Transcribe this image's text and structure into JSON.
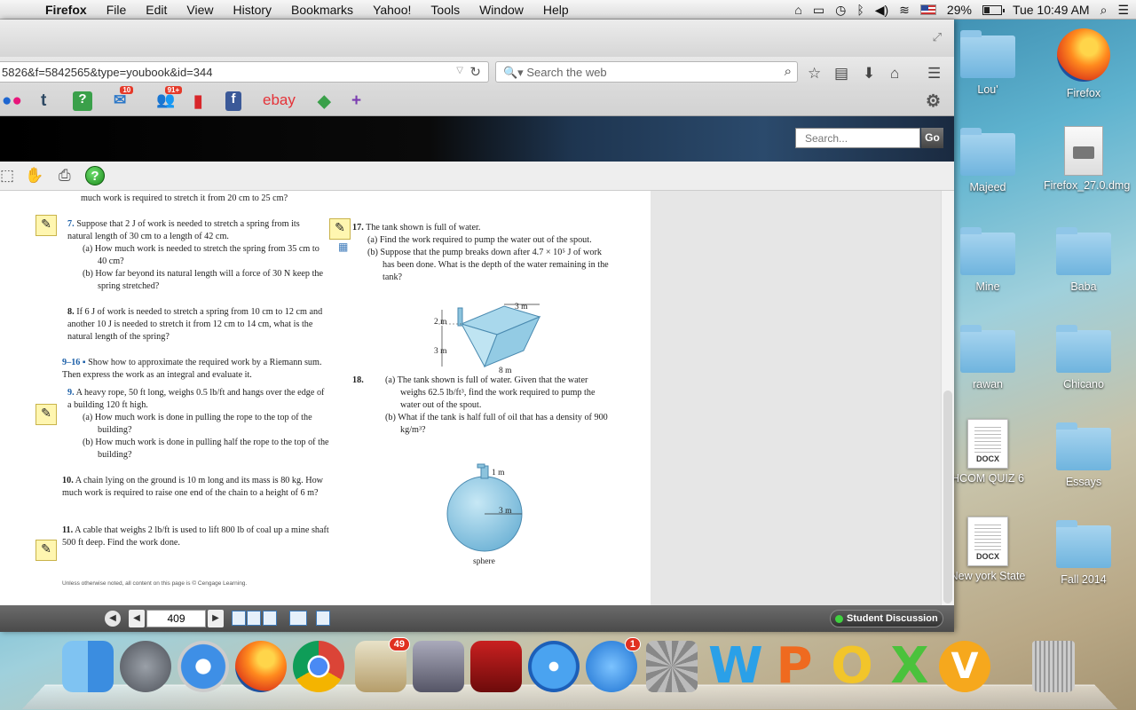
{
  "menubar": {
    "app": "Firefox",
    "items": [
      "File",
      "Edit",
      "View",
      "History",
      "Bookmarks",
      "Yahoo!",
      "Tools",
      "Window",
      "Help"
    ],
    "battery": "29%",
    "clock": "Tue 10:49 AM"
  },
  "browser": {
    "url": "5826&f=5842565&type=youbook&id=344",
    "search_placeholder": "Search the web",
    "bookmarks_badges": {
      "mail": "10",
      "social": "91+"
    },
    "bookmark_ebay": "ebay",
    "site_search_placeholder": "Search...",
    "site_go": "Go"
  },
  "page": {
    "top_line": "much work is required to stretch it from 20 cm to 25 cm?",
    "p7": {
      "num": "7.",
      "text": "Suppose that 2 J of work is needed to stretch a spring from its natural length of 30 cm to a length of 42 cm.",
      "a": "(a) How much work is needed to stretch the spring from 35 cm to 40 cm?",
      "b": "(b) How far beyond its natural length will a force of 30 N keep the spring stretched?"
    },
    "p8": {
      "num": "8.",
      "text": "If 6 J of work is needed to stretch a spring from 10 cm to 12 cm and another 10 J is needed to stretch it from 12 cm to 14 cm, what is the natural length of the spring?"
    },
    "p9_16": {
      "num": "9–16 ▪",
      "text": "Show how to approximate the required work by a Riemann sum. Then express the work as an integral and evaluate it."
    },
    "p9": {
      "num": "9.",
      "text": "A heavy rope, 50 ft long, weighs 0.5 lb/ft and hangs over the edge of a building 120 ft high.",
      "a": "(a) How much work is done in pulling the rope to the top of the building?",
      "b": "(b) How much work is done in pulling half the rope to the top of the building?"
    },
    "p10": {
      "num": "10.",
      "text": "A chain lying on the ground is 10 m long and its mass is 80 kg. How much work is required to raise one end of the chain to a height of 6 m?"
    },
    "p11": {
      "num": "11.",
      "text": "A cable that weighs 2 lb/ft is used to lift 800 lb of coal up a mine shaft 500 ft deep. Find the work done."
    },
    "footer": "Unless otherwise noted, all content on this page is © Cengage Learning.",
    "p17": {
      "num": "17.",
      "text": "The tank shown is full of water.",
      "a": "(a) Find the work required to pump the water out of the spout.",
      "b": "(b) Suppose that the pump breaks down after 4.7 × 10⁵ J of work has been done. What is the depth of the water remaining in the tank?",
      "fig": {
        "top": "3 m",
        "spout": "2 m",
        "height": "3 m",
        "base": "8 m"
      }
    },
    "p18": {
      "num": "18.",
      "a": "(a) The tank shown is full of water. Given that the water weighs 62.5 lb/ft³, find the work required to pump the water out of the spout.",
      "b": "(b) What if the tank is half full of oil that has a density of 900 kg/m³?",
      "fig": {
        "spout": "1 m",
        "radius": "3 m",
        "caption": "sphere"
      }
    }
  },
  "bottombar": {
    "page_number": "409",
    "student_discussion": "Student Discussion"
  },
  "desktop_icons": [
    {
      "label": "Lou'"
    },
    {
      "label": "Firefox"
    },
    {
      "label": "Majeed"
    },
    {
      "label": "Firefox_27.0.dmg"
    },
    {
      "label": "Mine"
    },
    {
      "label": "Baba"
    },
    {
      "label": "rawan"
    },
    {
      "label": "Chicano"
    },
    {
      "label": "HCOM QUIZ 6",
      "tag": "DOCX"
    },
    {
      "label": "Essays"
    },
    {
      "label": "New york State",
      "tag": "DOCX"
    },
    {
      "label": "Fall 2014"
    }
  ],
  "dock": {
    "mail_badge": "49",
    "appstore_badge": "1"
  }
}
